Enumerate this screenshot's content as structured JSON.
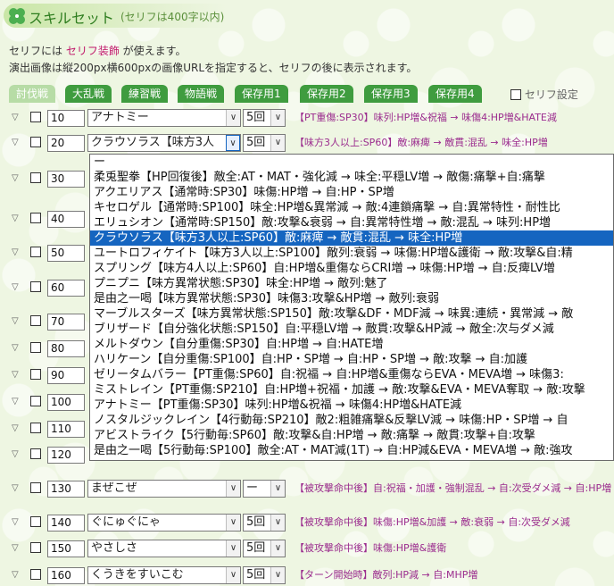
{
  "header": {
    "title": "スキルセット",
    "note": "(セリフは400字以内)"
  },
  "description": {
    "line1_prefix": "セリフには ",
    "line1_link": "セリフ装飾",
    "line1_suffix": " が使えます。",
    "line2": "演出画像は縦200px横600pxの画像URLを指定すると、セリフの後に表示されます。"
  },
  "tabs": [
    "討伐戦",
    "大乱戦",
    "練習戦",
    "物語戦",
    "保存用1",
    "保存用2",
    "保存用3",
    "保存用4"
  ],
  "active_tab": "討伐戦",
  "dialog_setting_label": "セリフ設定",
  "rows": [
    {
      "num": "10",
      "skill": "アナトミー",
      "level": "5回",
      "desc": "【PT重傷:SP30】味列:HP増&祝福 → 味傷4:HP増&HATE減"
    },
    {
      "num": "20",
      "skill": "クラウソラス【味方3人",
      "level": "5回",
      "desc": "【味方3人以上:SP60】敵:麻痺 → 敵貫:混乱 → 味全:HP増"
    },
    {
      "num": "30"
    },
    {
      "num": "40"
    },
    {
      "num": "50"
    },
    {
      "num": "60"
    },
    {
      "num": "70"
    },
    {
      "num": "80"
    },
    {
      "num": "90"
    },
    {
      "num": "100"
    },
    {
      "num": "110"
    },
    {
      "num": "120"
    },
    {
      "num": "130",
      "skill": "まぜこぜ",
      "level": "ー",
      "desc": "【被攻撃命中後】自:祝福・加護・強制混乱 → 自:次受ダメ減 → 自:HP増"
    },
    {
      "num": "140",
      "skill": "ぐにゅぐにゃ",
      "level": "5回",
      "desc": "【被攻撃命中後】味傷:HP増&加護 → 敵:衰弱 → 自:次受ダメ減"
    },
    {
      "num": "150",
      "skill": "やさしさ",
      "level": "5回",
      "desc": "【被攻撃命中後】味傷:HP増&護衛"
    },
    {
      "num": "160",
      "skill": "くうきをすいこむ",
      "level": "5回",
      "desc": "【ターン開始時】敵列:HP減 → 自:MHP増"
    }
  ],
  "dropdown": {
    "options": [
      "ー",
      "柔兎聖拳【HP回復後】敵全:AT・MAT・強化減 → 味全:平穏LV増 → 敵傷:痛撃+自:痛撃",
      "アクエリアス【通常時:SP30】味傷:HP増 → 自:HP・SP増",
      "キセロゲル【通常時:SP100】味全:HP増&異常減 → 敵:4連鎖痛撃 → 自:異常特性・耐性比",
      "エリュシオン【通常時:SP150】敵:攻撃&衰弱 → 自:異常特性増 → 敵:混乱 → 味列:HP増",
      "クラウソラス【味方3人以上:SP60】敵:麻痺 → 敵貫:混乱 → 味全:HP増",
      "ユートロフィケイト【味方3人以上:SP100】敵列:衰弱 → 味傷:HP増&護衛 → 敵:攻撃&自:精",
      "スプリング【味方4人以上:SP60】自:HP増&重傷ならCRI増 → 味傷:HP増 → 自:反痺LV増",
      "プニプニ【味方異常状態:SP30】味全:HP増 → 敵列:魅了",
      "是由之一喝【味方異常状態:SP30】味傷3:攻撃&HP増 → 敵列:衰弱",
      "マーブルスターズ【味方異常状態:SP150】敵:攻撃&DF・MDF減 → 味異:連続・異常減 → 敵",
      "ブリザード【自分強化状態:SP150】自:平穏LV増 → 敵貫:攻撃&HP減 → 敵全:次与ダメ減",
      "メルトダウン【自分重傷:SP30】自:HP増 → 自:HATE増",
      "ハリケーン【自分重傷:SP100】自:HP・SP増 → 自:HP・SP増 → 敵:攻撃 → 自:加護",
      "ゼリータムバラー【PT重傷:SP60】自:祝福 → 自:HP増&重傷ならEVA・MEVA増 → 味傷3:",
      "ミストレイン【PT重傷:SP210】自:HP増+祝福・加護 → 敵:攻撃&EVA・MEVA奪取 → 敵:攻撃",
      "アナトミー【PT重傷:SP30】味列:HP増&祝福 → 味傷4:HP増&HATE減",
      "ノスタルジックレイン【4行動毎:SP210】敵2:粗雑痛撃&反撃LV減 → 味傷:HP・SP増 → 自",
      "アビストライク【5行動毎:SP60】敵:攻撃&自:HP増 → 敵:痛撃 → 敵貫:攻撃+自:攻撃",
      "是由之一喝【5行動毎:SP100】敵全:AT・MAT減(1T) → 自:HP減&EVA・MEVA増 → 敵:強攻"
    ],
    "selected_index": 5
  }
}
